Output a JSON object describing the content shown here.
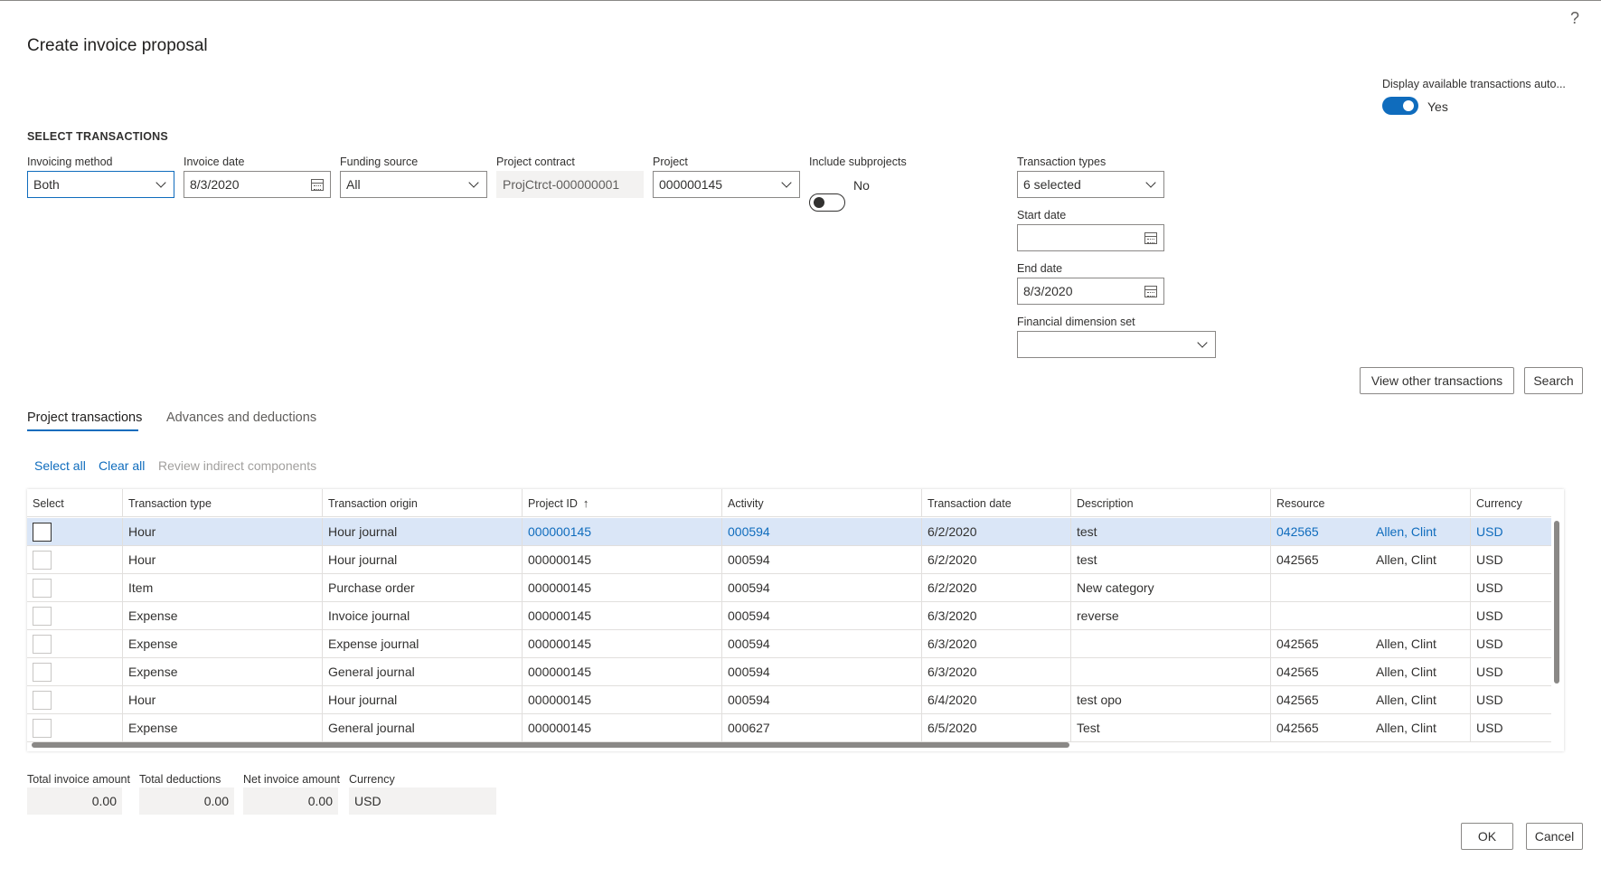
{
  "dialog": {
    "title": "Create invoice proposal",
    "help_glyph": "?"
  },
  "auto_display": {
    "label": "Display available transactions auto...",
    "toggle_label": "Yes",
    "on": true
  },
  "section": {
    "title": "SELECT TRANSACTIONS"
  },
  "fields": {
    "invoicing_method": {
      "label": "Invoicing method",
      "value": "Both"
    },
    "invoice_date": {
      "label": "Invoice date",
      "value": "8/3/2020"
    },
    "funding_source": {
      "label": "Funding source",
      "value": "All"
    },
    "project_contract": {
      "label": "Project contract",
      "value": "ProjCtrct-000000001"
    },
    "project": {
      "label": "Project",
      "value": "000000145"
    },
    "include_subprojects": {
      "label": "Include subprojects",
      "toggle_label": "No",
      "on": false
    },
    "transaction_types": {
      "label": "Transaction types",
      "value": "6 selected"
    },
    "start_date": {
      "label": "Start date",
      "value": ""
    },
    "end_date": {
      "label": "End date",
      "value": "8/3/2020"
    },
    "financial_dimension_set": {
      "label": "Financial dimension set",
      "value": ""
    }
  },
  "buttons": {
    "view_other": "View other transactions",
    "search": "Search",
    "ok": "OK",
    "cancel": "Cancel"
  },
  "tabs": [
    {
      "label": "Project transactions",
      "active": true
    },
    {
      "label": "Advances and deductions",
      "active": false
    }
  ],
  "grid_actions": {
    "select_all": "Select all",
    "clear_all": "Clear all",
    "review_indirect": "Review indirect components"
  },
  "grid": {
    "columns": [
      "Select",
      "Transaction type",
      "Transaction origin",
      "Project ID",
      "Activity",
      "Transaction date",
      "Description",
      "Resource",
      "",
      "Currency"
    ],
    "sort_arrow": "↑",
    "rows": [
      {
        "type": "Hour",
        "origin": "Hour journal",
        "project_id": "000000145",
        "activity": "000594",
        "date": "6/2/2020",
        "description": "test",
        "resource": "042565",
        "resource_name": "Allen, Clint",
        "currency": "USD"
      },
      {
        "type": "Hour",
        "origin": "Hour journal",
        "project_id": "000000145",
        "activity": "000594",
        "date": "6/2/2020",
        "description": "test",
        "resource": "042565",
        "resource_name": "Allen, Clint",
        "currency": "USD"
      },
      {
        "type": "Item",
        "origin": "Purchase order",
        "project_id": "000000145",
        "activity": "000594",
        "date": "6/2/2020",
        "description": "New category",
        "resource": "",
        "resource_name": "",
        "currency": "USD"
      },
      {
        "type": "Expense",
        "origin": "Invoice journal",
        "project_id": "000000145",
        "activity": "000594",
        "date": "6/3/2020",
        "description": "reverse",
        "resource": "",
        "resource_name": "",
        "currency": "USD"
      },
      {
        "type": "Expense",
        "origin": "Expense journal",
        "project_id": "000000145",
        "activity": "000594",
        "date": "6/3/2020",
        "description": "",
        "resource": "042565",
        "resource_name": "Allen, Clint",
        "currency": "USD"
      },
      {
        "type": "Expense",
        "origin": "General journal",
        "project_id": "000000145",
        "activity": "000594",
        "date": "6/3/2020",
        "description": "",
        "resource": "042565",
        "resource_name": "Allen, Clint",
        "currency": "USD"
      },
      {
        "type": "Hour",
        "origin": "Hour journal",
        "project_id": "000000145",
        "activity": "000594",
        "date": "6/4/2020",
        "description": "test opo",
        "resource": "042565",
        "resource_name": "Allen, Clint",
        "currency": "USD"
      },
      {
        "type": "Expense",
        "origin": "General journal",
        "project_id": "000000145",
        "activity": "000627",
        "date": "6/5/2020",
        "description": "Test",
        "resource": "042565",
        "resource_name": "Allen, Clint",
        "currency": "USD"
      }
    ]
  },
  "totals": {
    "total_invoice": {
      "label": "Total invoice amount",
      "value": "0.00"
    },
    "total_deductions": {
      "label": "Total deductions",
      "value": "0.00"
    },
    "net_invoice": {
      "label": "Net invoice amount",
      "value": "0.00"
    },
    "currency": {
      "label": "Currency",
      "value": "USD"
    }
  },
  "colors": {
    "accent": "#0f6cbd",
    "selected_row": "#dae6f7",
    "readonly_bg": "#f3f2f1"
  },
  "icons": [
    "help-icon",
    "chevron-down-icon",
    "calendar-icon",
    "sort-ascending-icon",
    "checkbox-icon"
  ]
}
